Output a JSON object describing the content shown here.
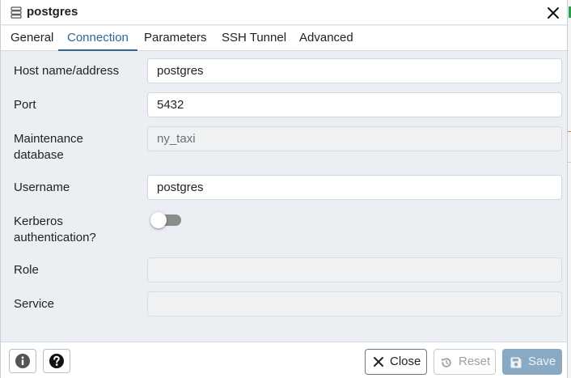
{
  "dialog": {
    "title": "postgres",
    "icons": {
      "title": "server-icon",
      "close": "close-icon"
    }
  },
  "tabs": [
    {
      "label": "General",
      "active": false
    },
    {
      "label": "Connection",
      "active": true
    },
    {
      "label": "Parameters",
      "active": false
    },
    {
      "label": "SSH Tunnel",
      "active": false
    },
    {
      "label": "Advanced",
      "active": false
    }
  ],
  "form": {
    "host": {
      "label": "Host name/address",
      "value": "postgres"
    },
    "port": {
      "label": "Port",
      "value": "5432"
    },
    "maintenance_db": {
      "label_line1": "Maintenance",
      "label_line2": "database",
      "value": "ny_taxi",
      "disabled": true
    },
    "username": {
      "label": "Username",
      "value": "postgres"
    },
    "kerberos": {
      "label_line1": "Kerberos",
      "label_line2": "authentication?",
      "enabled": false
    },
    "role": {
      "label": "Role",
      "value": "",
      "disabled": true
    },
    "service": {
      "label": "Service",
      "value": "",
      "disabled": true
    }
  },
  "footer": {
    "info_icon": "info-icon",
    "help_icon": "help-icon",
    "close_label": "Close",
    "reset_label": "Reset",
    "save_label": "Save",
    "save_enabled": false,
    "reset_enabled": false
  },
  "colors": {
    "accent": "#326690",
    "background": "#ebeef3",
    "save_disabled": "#8aa9c3"
  }
}
